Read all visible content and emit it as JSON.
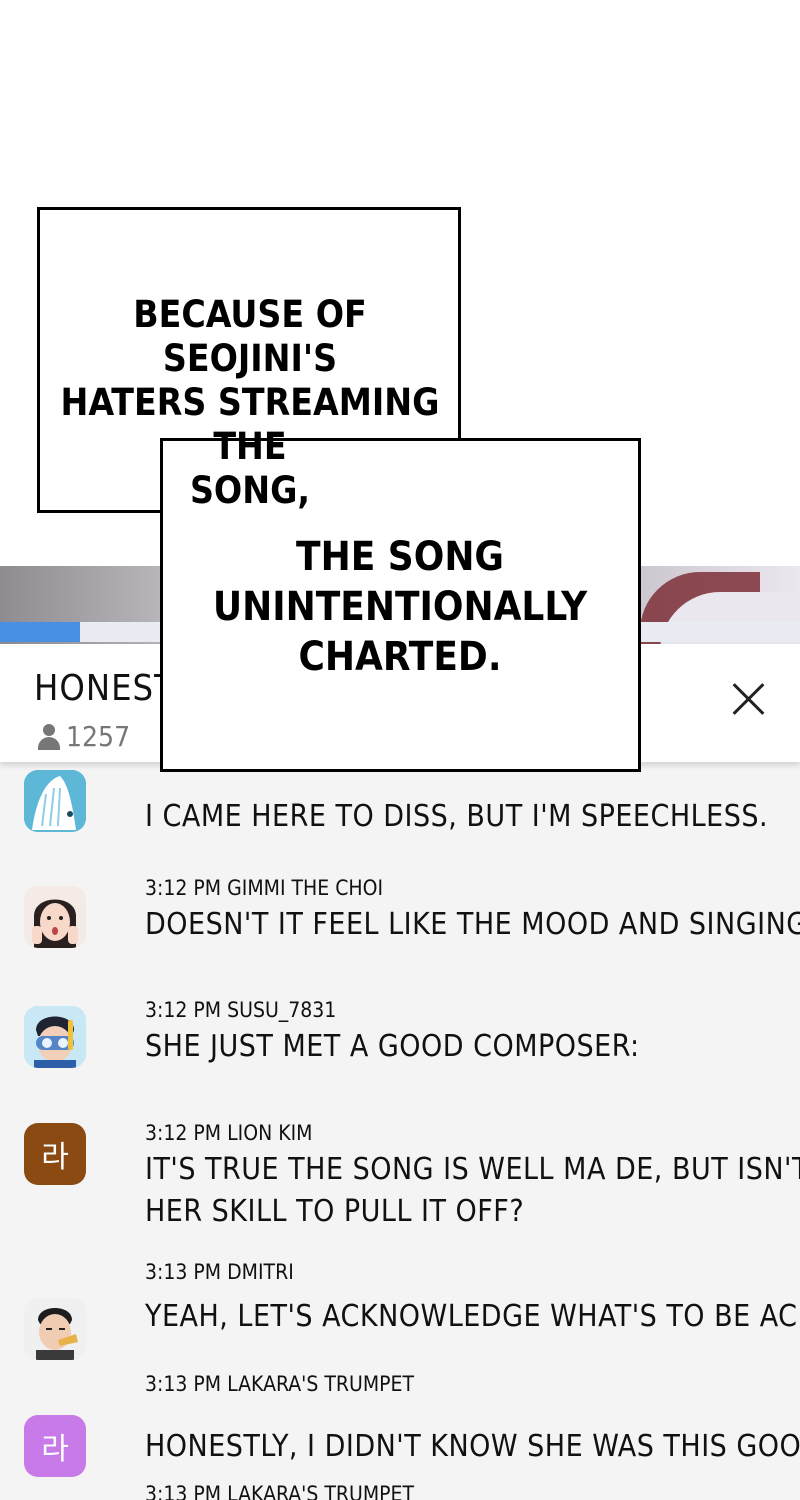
{
  "panel": {
    "caption_1": [
      "BECAUSE OF SEOJINI'S",
      "HATERS STREAMING THE",
      "SONG,"
    ],
    "caption_2": [
      "THE SONG",
      "UNINTENTIONALLY",
      "CHARTED."
    ]
  },
  "stream": {
    "title": "HONESTL",
    "viewers": "1257",
    "progress": 0.1
  },
  "chat": [
    {
      "time": "",
      "user": "",
      "text": [
        "I CAME HERE TO DISS, BUT I'M SPEECHLESS."
      ],
      "avatar": "whale-icon"
    },
    {
      "time": "3:12 PM",
      "user": "GIMMI THE CHOI",
      "text": [
        "DOESN'T IT FEEL LIKE THE MOOD AND SINGING STYLE H"
      ],
      "avatar": "surprised-girl-icon"
    },
    {
      "time": "3:12 PM",
      "user": "SUSU_7831",
      "text": [
        "SHE JUST MET A GOOD COMPOSER:"
      ],
      "avatar": "snorkel-boy-icon"
    },
    {
      "time": "3:12 PM",
      "user": "LION KIM",
      "text": [
        "IT'S TRUE THE SONG IS WELL MA DE, BUT ISN'T IT ALS",
        "HER SKILL TO PULL IT OFF?"
      ],
      "avatar_char": "라",
      "avatar_color": "#8a4a12"
    },
    {
      "time": "3:13 PM",
      "user": "DMITRI",
      "text": [
        "YEAH, LET'S ACKNOWLEDGE WHAT'S TO BE ACKNOWLED"
      ],
      "avatar": "man-eating-icon"
    },
    {
      "time": "3:13 PM",
      "user": "LAKARA'S TRUMPET",
      "text": [
        "HONESTLY, I DIDN'T KNOW SHE WAS THIS GOOD AT SIN"
      ],
      "avatar_char": "라",
      "avatar_color": "#c77ae8"
    },
    {
      "time": "3:13 PM",
      "user": "LAKARA'S TRUMPET",
      "text": [],
      "avatar": ""
    }
  ]
}
